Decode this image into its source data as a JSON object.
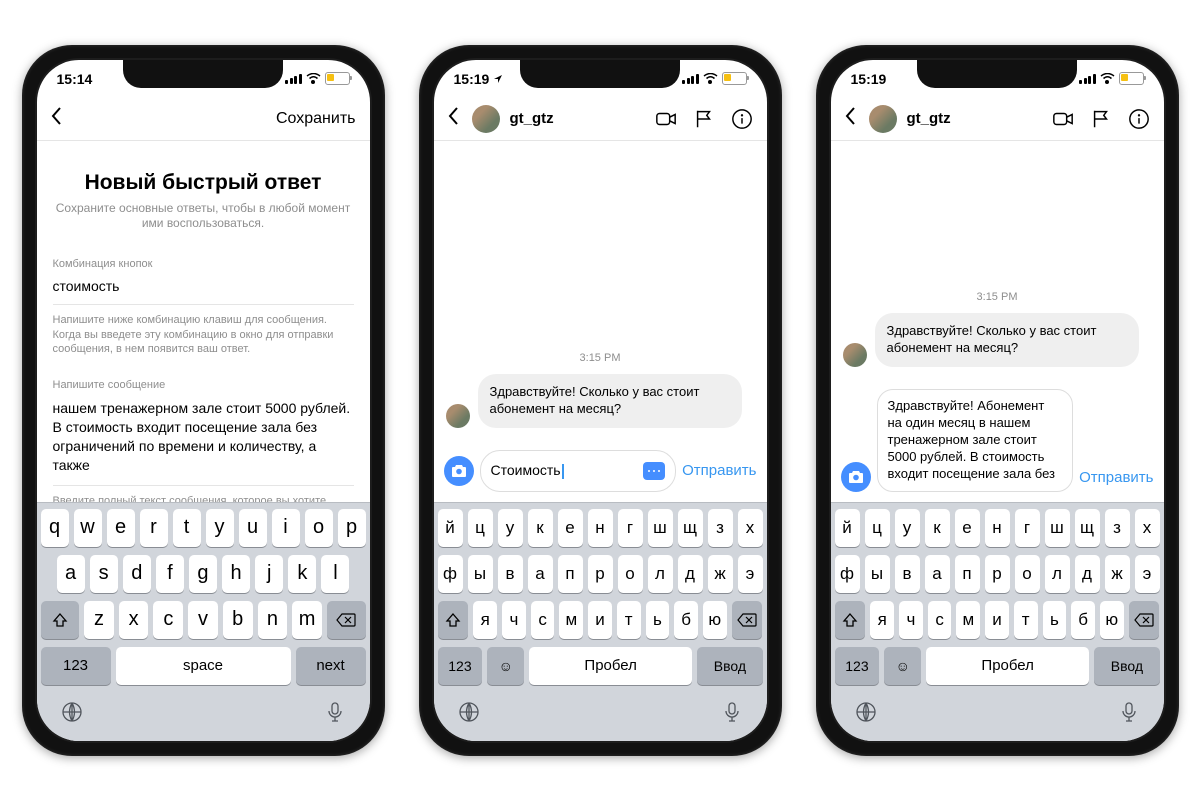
{
  "phone1": {
    "time": "15:14",
    "save": "Сохранить",
    "title": "Новый быстрый ответ",
    "subtitle": "Сохраните основные ответы, чтобы в любой момент ими воспользоваться.",
    "shortcut_label": "Комбинация кнопок",
    "shortcut_value": "стоимость",
    "shortcut_hint": "Напишите ниже комбинацию клавиш для сообщения. Когда вы введете эту комбинацию в окно для отправки сообщения, в нем появится ваш ответ.",
    "message_label": "Напишите сообщение",
    "message_value": "нашем тренажерном зале стоит 5000 рублей. В стоимость входит посещение зала без ограничений по времени и количеству, а также",
    "message_hint": "Введите полный текст сообщения, которое вы хотите отправлять клиентам.",
    "kbd": {
      "r1": [
        "q",
        "w",
        "e",
        "r",
        "t",
        "y",
        "u",
        "i",
        "o",
        "p"
      ],
      "r2": [
        "a",
        "s",
        "d",
        "f",
        "g",
        "h",
        "j",
        "k",
        "l"
      ],
      "r3": [
        "z",
        "x",
        "c",
        "v",
        "b",
        "n",
        "m"
      ],
      "num": "123",
      "space": "space",
      "next": "next"
    }
  },
  "phone2": {
    "time": "15:19",
    "user": "gt_gtz",
    "timestamp": "3:15 PM",
    "msg": "Здравствуйте! Сколько у вас стоит абонемент на месяц?",
    "input": "Стоимость",
    "send": "Отправить",
    "kbd": {
      "r1": [
        "й",
        "ц",
        "у",
        "к",
        "е",
        "н",
        "г",
        "ш",
        "щ",
        "з",
        "х"
      ],
      "r2": [
        "ф",
        "ы",
        "в",
        "а",
        "п",
        "р",
        "о",
        "л",
        "д",
        "ж",
        "э"
      ],
      "r3": [
        "я",
        "ч",
        "с",
        "м",
        "и",
        "т",
        "ь",
        "б",
        "ю"
      ],
      "num": "123",
      "space": "Пробел",
      "enter": "Ввод"
    }
  },
  "phone3": {
    "time": "15:19",
    "user": "gt_gtz",
    "timestamp": "3:15 PM",
    "msg": "Здравствуйте! Сколько у вас стоит абонемент на месяц?",
    "reply": "Здравствуйте! Абонемент на один месяц в нашем тренажерном зале стоит 5000 рублей. В стоимость входит посещение зала без",
    "send": "Отправить",
    "kbd": {
      "r1": [
        "й",
        "ц",
        "у",
        "к",
        "е",
        "н",
        "г",
        "ш",
        "щ",
        "з",
        "х"
      ],
      "r2": [
        "ф",
        "ы",
        "в",
        "а",
        "п",
        "р",
        "о",
        "л",
        "д",
        "ж",
        "э"
      ],
      "r3": [
        "я",
        "ч",
        "с",
        "м",
        "и",
        "т",
        "ь",
        "б",
        "ю"
      ],
      "num": "123",
      "space": "Пробел",
      "enter": "Ввод"
    }
  }
}
